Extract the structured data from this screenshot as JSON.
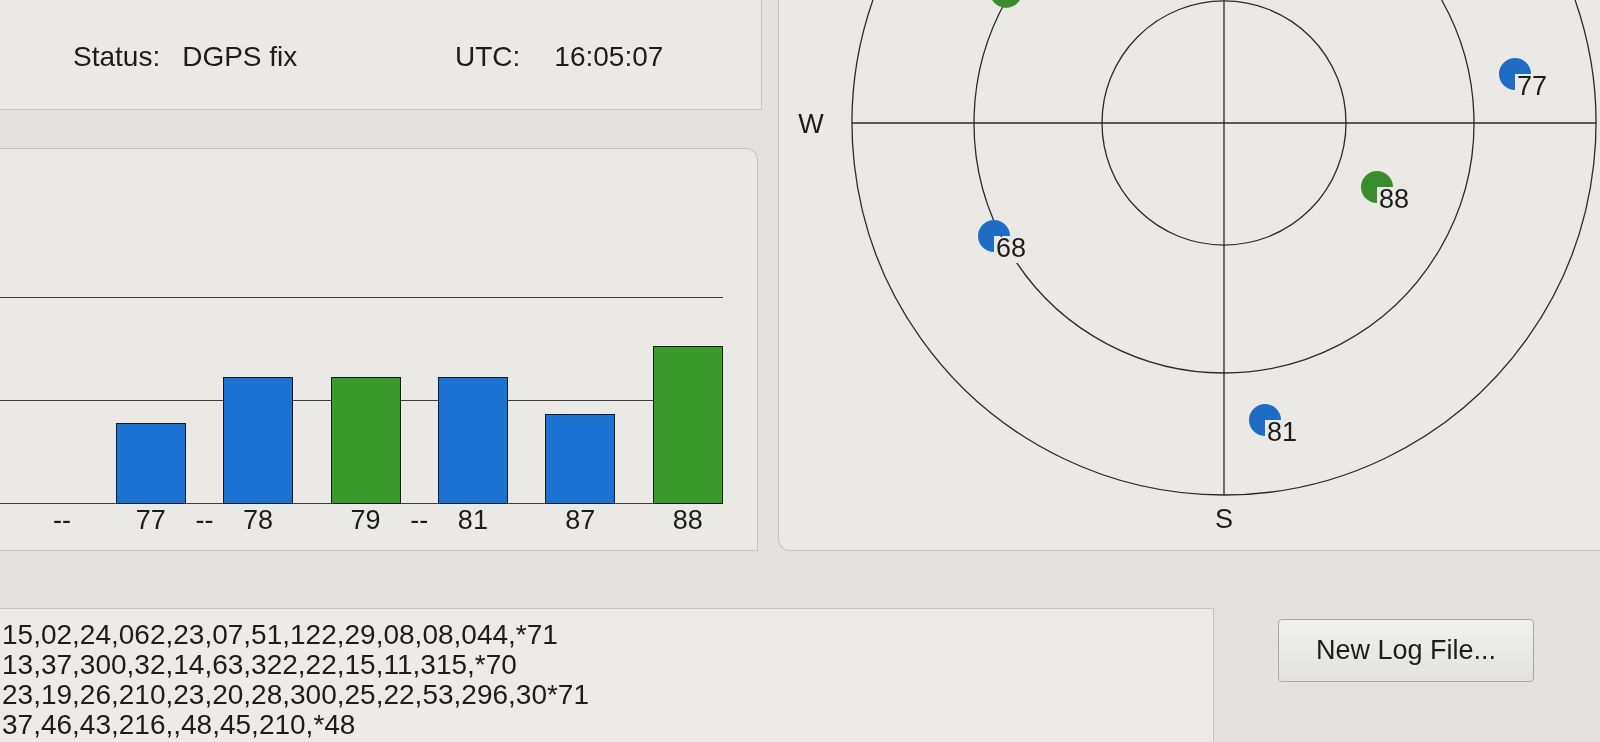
{
  "status_panel": {
    "fields": [
      {
        "label": "Status:",
        "value": "DGPS fix"
      },
      {
        "label": "UTC:",
        "value": "16:05:07"
      }
    ]
  },
  "signal_chart": {
    "channels": [
      {
        "kind": "empty",
        "label": "--"
      },
      {
        "kind": "bar",
        "label": "77",
        "level": 0.26,
        "color": "#1a73d2"
      },
      {
        "kind": "empty",
        "label": "--"
      },
      {
        "kind": "bar",
        "label": "78",
        "level": 0.41,
        "color": "#1a73d2"
      },
      {
        "kind": "bar",
        "label": "79",
        "level": 0.41,
        "color": "#3a9a2a"
      },
      {
        "kind": "empty",
        "label": "--"
      },
      {
        "kind": "bar",
        "label": "81",
        "level": 0.41,
        "color": "#1a73d2"
      },
      {
        "kind": "bar",
        "label": "87",
        "level": 0.29,
        "color": "#1a73d2"
      },
      {
        "kind": "bar",
        "label": "88",
        "level": 0.51,
        "color": "#3a9a2a"
      }
    ]
  },
  "sky_plot": {
    "compass": [
      {
        "kind": "west",
        "label": "W"
      },
      {
        "kind": "south",
        "label": "S"
      }
    ],
    "satellites": [
      {
        "color": "#3a8c2c"
      },
      {
        "label": "77",
        "color": "#1f6cc4"
      },
      {
        "label": "88",
        "color": "#3a8c2c"
      },
      {
        "label": "68",
        "color": "#1f6cc4"
      },
      {
        "label": "81",
        "color": "#1f6cc4"
      }
    ]
  },
  "nmea_log": {
    "lines": [
      "15,02,24,062,23,07,51,122,29,08,08,044,*71",
      "13,37,300,32,14,63,322,22,15,11,315,*70",
      "23,19,26,210,23,20,28,300,25,22,53,296,30*71",
      "37,46,43,216,,48,45,210,*48"
    ]
  },
  "buttons": [
    {
      "label": "New Log File..."
    }
  ]
}
